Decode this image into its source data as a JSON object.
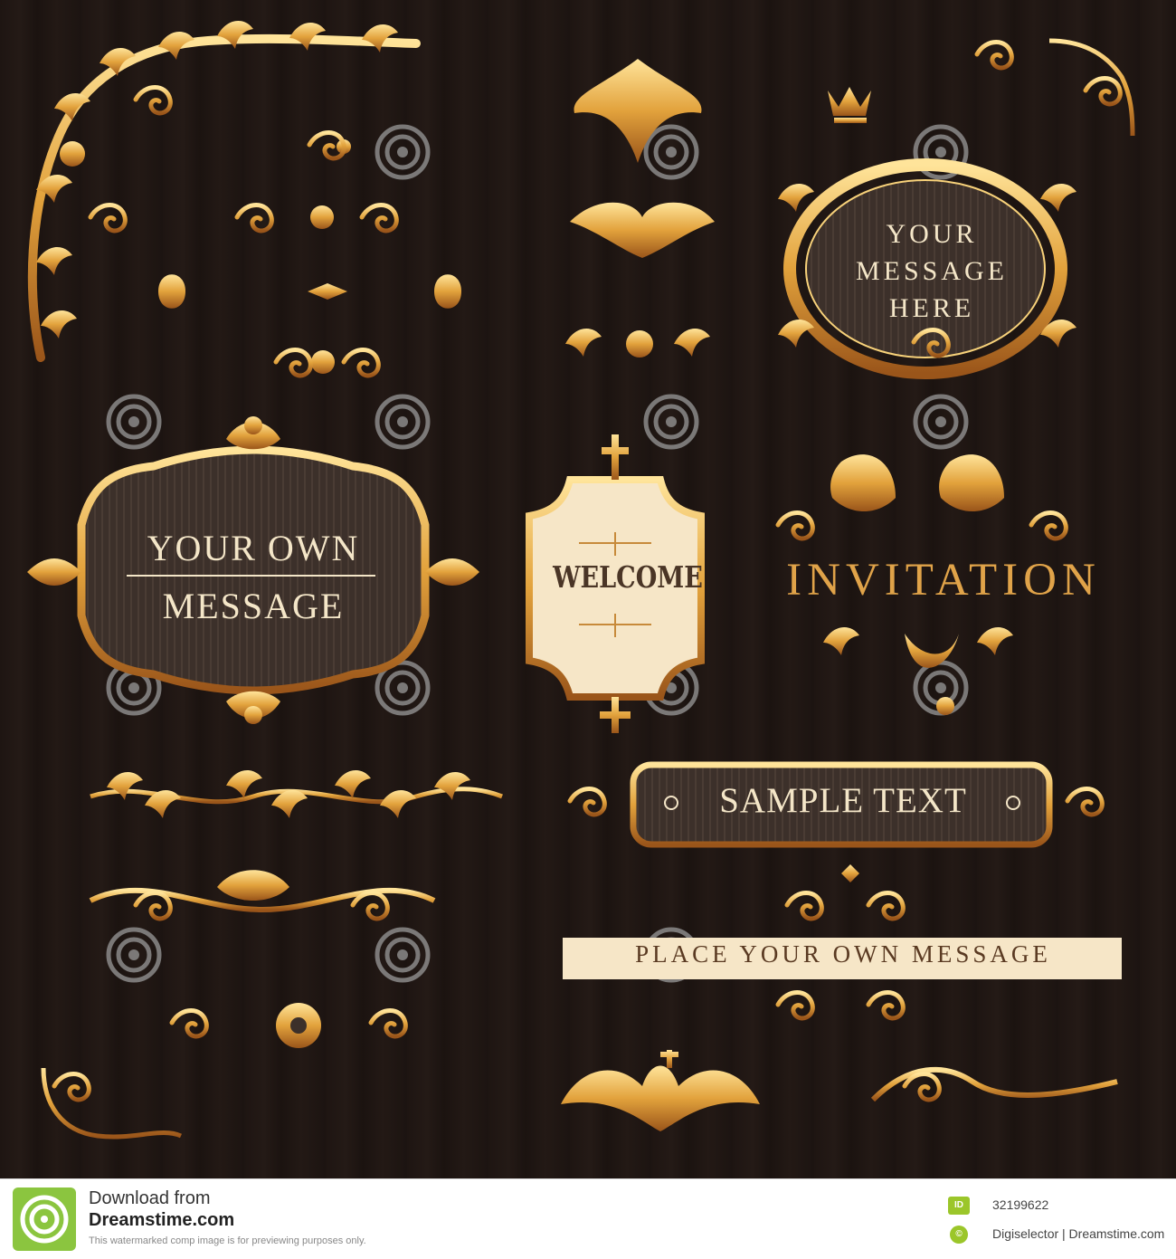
{
  "artwork": {
    "frame_oval_text": "YOUR\nMESSAGE\nHERE",
    "own_message_line1": "YOUR OWN",
    "own_message_line2": "MESSAGE",
    "welcome_text": "WELCOME",
    "invitation_text": "INVITATION",
    "sample_text": "SAMPLE TEXT",
    "banner_text": "PLACE YOUR OWN MESSAGE",
    "watermark_text": "dreamstime",
    "colors": {
      "background": "#1e1512",
      "gold": "#e2a23c",
      "gold_light": "#f8d27a",
      "gold_dark": "#a05e1c",
      "cream": "#f6e6c7",
      "panel": "#3c302a"
    }
  },
  "footer": {
    "download_label": "Download from",
    "site": "Dreamstime.com",
    "note": "This watermarked comp image is for previewing purposes only.",
    "id_badge": "ID",
    "image_id": "32199622",
    "credit_badge": "©",
    "credit": "Digiselector | Dreamstime.com",
    "colors": {
      "badge": "#9bc62a",
      "logo": "#8bc53f"
    }
  }
}
